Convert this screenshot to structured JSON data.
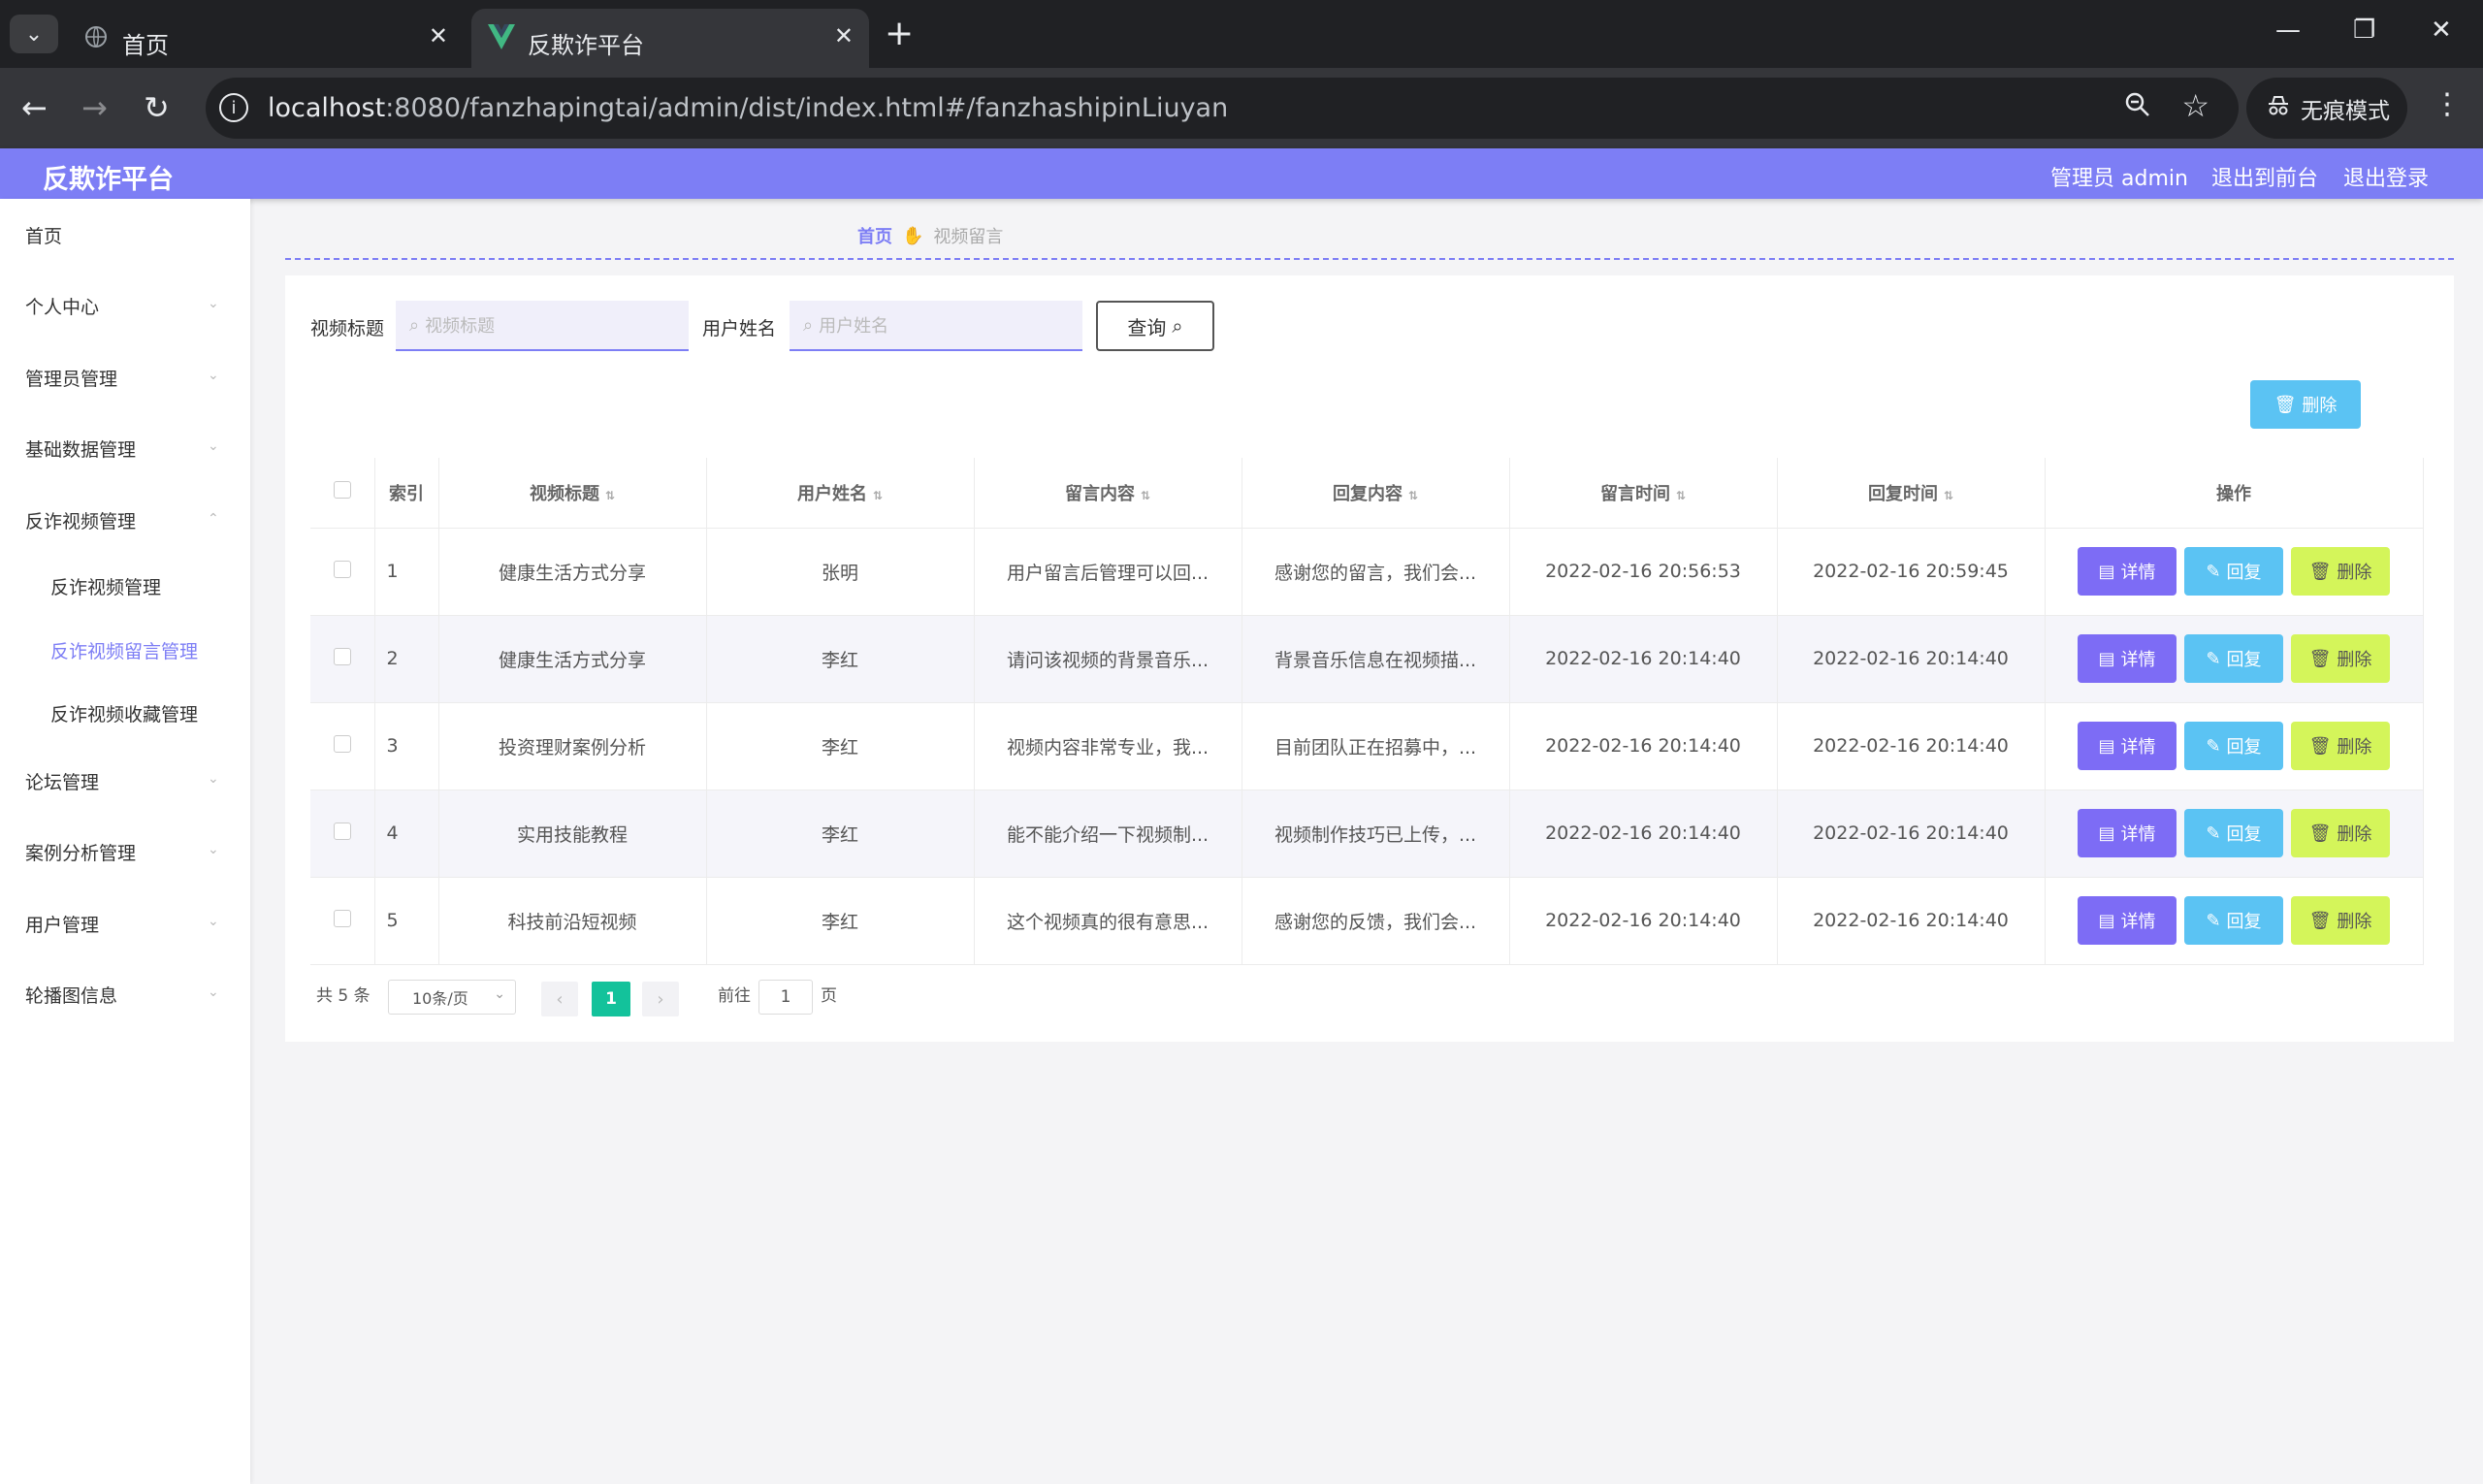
{
  "browser": {
    "tabs": [
      {
        "title": "首页"
      },
      {
        "title": "反欺诈平台"
      }
    ],
    "url_host": "localhost",
    "url_rest": ":8080/fanzhapingtai/admin/dist/index.html#/fanzhashipinLiuyan",
    "incognito_label": "无痕模式"
  },
  "header": {
    "title": "反欺诈平台",
    "links": [
      "管理员 admin",
      "退出到前台",
      "退出登录"
    ]
  },
  "sidebar": {
    "items": [
      {
        "label": "首页"
      },
      {
        "label": "个人中心"
      },
      {
        "label": "管理员管理"
      },
      {
        "label": "基础数据管理"
      },
      {
        "label": "反诈视频管理"
      },
      {
        "label": "论坛管理"
      },
      {
        "label": "案例分析管理"
      },
      {
        "label": "用户管理"
      },
      {
        "label": "轮播图信息"
      }
    ],
    "subitems": [
      {
        "label": "反诈视频管理"
      },
      {
        "label": "反诈视频留言管理"
      },
      {
        "label": "反诈视频收藏管理"
      }
    ]
  },
  "breadcrumb": {
    "home": "首页",
    "current": "视频留言"
  },
  "search": {
    "field1_label": "视频标题",
    "field1_placeholder": "视频标题",
    "field2_label": "用户姓名",
    "field2_placeholder": "用户姓名",
    "query_label": "查询",
    "delete_label": "删除"
  },
  "table": {
    "columns": [
      "索引",
      "视频标题",
      "用户姓名",
      "留言内容",
      "回复内容",
      "留言时间",
      "回复时间",
      "操作"
    ],
    "actions": {
      "detail": "详情",
      "reply": "回复",
      "delete": "删除"
    },
    "rows": [
      {
        "index": "1",
        "title": "健康生活方式分享",
        "user": "张明",
        "message": "用户留言后管理可以回...",
        "reply": "感谢您的留言，我们会...",
        "msg_time": "2022-02-16 20:56:53",
        "reply_time": "2022-02-16 20:59:45"
      },
      {
        "index": "2",
        "title": "健康生活方式分享",
        "user": "李红",
        "message": "请问该视频的背景音乐...",
        "reply": "背景音乐信息在视频描...",
        "msg_time": "2022-02-16 20:14:40",
        "reply_time": "2022-02-16 20:14:40"
      },
      {
        "index": "3",
        "title": "投资理财案例分析",
        "user": "李红",
        "message": "视频内容非常专业，我...",
        "reply": "目前团队正在招募中，...",
        "msg_time": "2022-02-16 20:14:40",
        "reply_time": "2022-02-16 20:14:40"
      },
      {
        "index": "4",
        "title": "实用技能教程",
        "user": "李红",
        "message": "能不能介绍一下视频制...",
        "reply": "视频制作技巧已上传，...",
        "msg_time": "2022-02-16 20:14:40",
        "reply_time": "2022-02-16 20:14:40"
      },
      {
        "index": "5",
        "title": "科技前沿短视频",
        "user": "李红",
        "message": "这个视频真的很有意思...",
        "reply": "感谢您的反馈，我们会...",
        "msg_time": "2022-02-16 20:14:40",
        "reply_time": "2022-02-16 20:14:40"
      }
    ]
  },
  "pagination": {
    "total": "共 5 条",
    "page_size": "10条/页",
    "current_page": "1",
    "goto_label": "前往",
    "goto_value": "1",
    "page_unit": "页"
  }
}
